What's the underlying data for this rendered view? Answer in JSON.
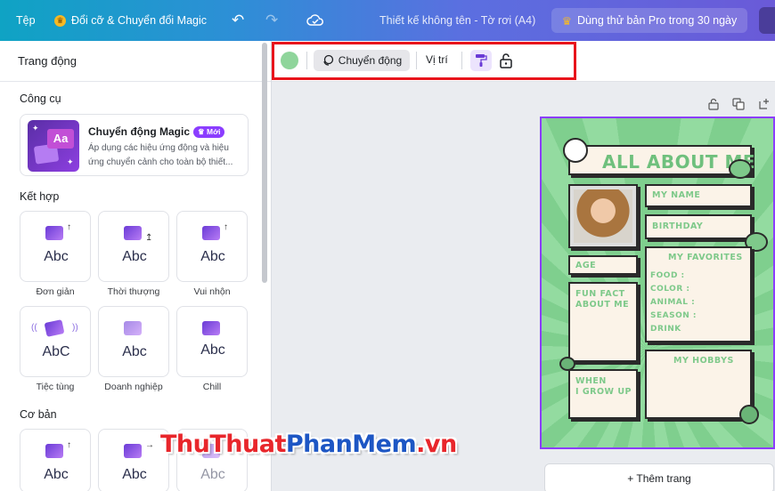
{
  "topbar": {
    "file_label": "Tệp",
    "resize_label": "Đổi cỡ & Chuyển đổi Magic",
    "doc_title": "Thiết kế không tên - Tờ rơi (A4)",
    "pro_label": "Dùng thử bản Pro trong 30 ngày"
  },
  "panel": {
    "title": "Trang động",
    "tools_heading": "Công cụ",
    "magic": {
      "title": "Chuyển động Magic",
      "badge": "Mới",
      "description": "Áp dụng các hiệu ứng động và hiệu ứng chuyển cảnh cho toàn bộ thiết..."
    },
    "combo_heading": "Kết hợp",
    "combo_tiles": [
      {
        "text": "Abc",
        "label": "Đơn giản"
      },
      {
        "text": "Abc",
        "label": "Thời thượng"
      },
      {
        "text": "Abc",
        "label": "Vui nhộn"
      },
      {
        "text": "AbC",
        "label": "Tiệc tùng"
      },
      {
        "text": "Abc",
        "label": "Doanh nghiệp"
      },
      {
        "text": "Abc",
        "label": "Chill"
      }
    ],
    "basic_heading": "Cơ bản",
    "basic_tiles": [
      {
        "text": "Abc"
      },
      {
        "text": "Abc"
      },
      {
        "text": "Abc"
      }
    ]
  },
  "toolbar": {
    "motion_label": "Chuyển động",
    "position_label": "Vị trí",
    "page_color": "#8fd59b"
  },
  "design": {
    "heading": "ALL ABOUT ME",
    "name": "MY NAME",
    "birthday": "BIRTHDAY",
    "age": "AGE",
    "favorites": "MY FAVORITES",
    "fav_items": [
      "FOOD :",
      "COLOR :",
      "ANIMAL :",
      "SEASON :",
      "DRINK"
    ],
    "fun_fact": "FUN FACT\nABOUT ME",
    "hobbys": "MY HOBBYS",
    "grow_up": "WHEN\nI GROW UP"
  },
  "add_page_label": "+ Thêm trang",
  "watermark": {
    "part1": "ThuThuat",
    "part2": "PhanMem",
    "part3": ".vn"
  }
}
